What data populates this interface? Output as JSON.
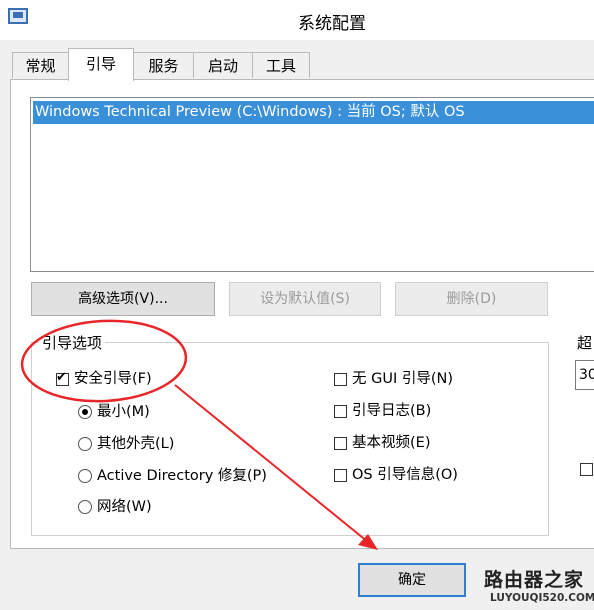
{
  "window": {
    "title": "系统配置",
    "icon": "msconfig-icon"
  },
  "tabs": [
    {
      "label": "常规",
      "active": false
    },
    {
      "label": "引导",
      "active": true
    },
    {
      "label": "服务",
      "active": false
    },
    {
      "label": "启动",
      "active": false
    },
    {
      "label": "工具",
      "active": false
    }
  ],
  "os_list": {
    "items": [
      {
        "label": "Windows Technical Preview (C:\\Windows) : 当前 OS; 默认 OS",
        "selected": true
      }
    ]
  },
  "buttons": {
    "advanced": "高级选项(V)...",
    "set_default": "设为默认值(S)",
    "delete": "删除(D)",
    "ok": "确定"
  },
  "boot_options": {
    "group_label": "引导选项",
    "safe_boot": {
      "label": "安全引导(F)",
      "checked": true
    },
    "radios": [
      {
        "label": "最小(M)",
        "checked": true
      },
      {
        "label": "其他外壳(L)",
        "checked": false
      },
      {
        "label": "Active Directory 修复(P)",
        "checked": false
      },
      {
        "label": "网络(W)",
        "checked": false
      }
    ],
    "checkboxes": [
      {
        "label": "无 GUI 引导(N)",
        "checked": false
      },
      {
        "label": "引导日志(B)",
        "checked": false
      },
      {
        "label": "基本视频(E)",
        "checked": false
      },
      {
        "label": "OS 引导信息(O)",
        "checked": false
      }
    ]
  },
  "timeout": {
    "label": "超",
    "value": "30"
  },
  "annotation": {
    "color": "#e8262a"
  },
  "watermark": {
    "main": "路由器之家",
    "url": "LUYOUQI520.COM"
  }
}
